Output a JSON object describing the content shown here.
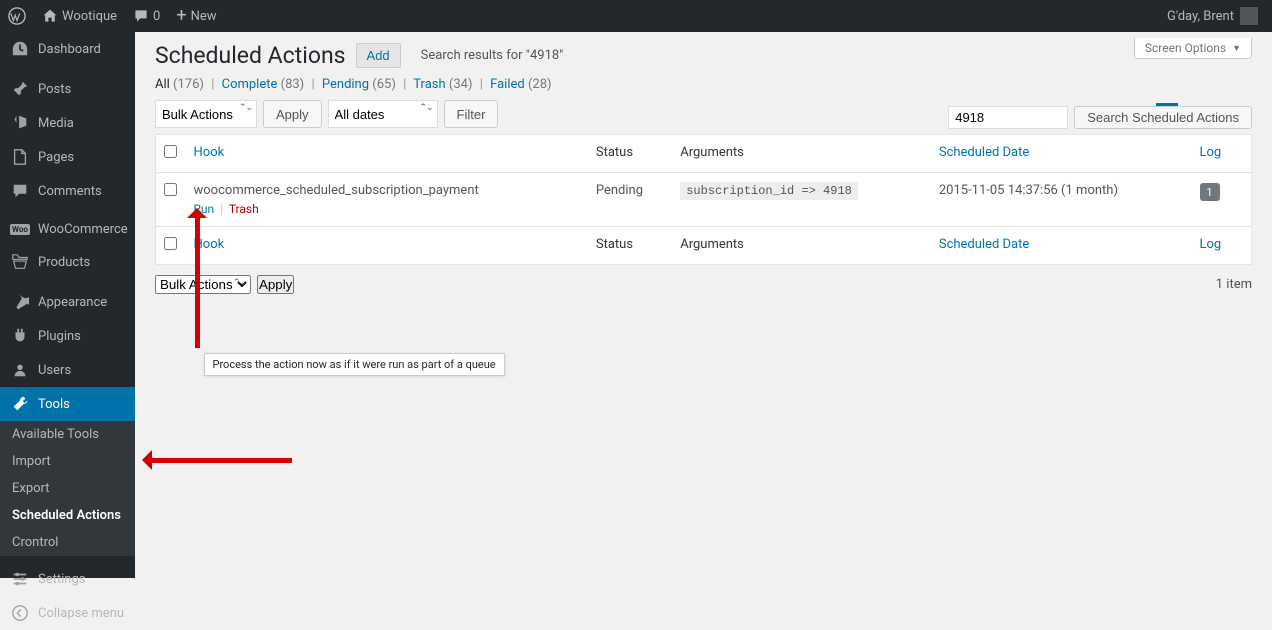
{
  "adminbar": {
    "site_name": "Wootique",
    "comments_count": "0",
    "new_label": "New",
    "greeting": "G'day, Brent"
  },
  "sidebar": {
    "items": [
      {
        "icon": "dashboard",
        "label": "Dashboard"
      },
      {
        "icon": "pin",
        "label": "Posts"
      },
      {
        "icon": "media",
        "label": "Media"
      },
      {
        "icon": "page",
        "label": "Pages"
      },
      {
        "icon": "comment",
        "label": "Comments"
      },
      {
        "icon": "woo",
        "label": "WooCommerce"
      },
      {
        "icon": "product",
        "label": "Products"
      },
      {
        "icon": "appearance",
        "label": "Appearance"
      },
      {
        "icon": "plugin",
        "label": "Plugins"
      },
      {
        "icon": "users",
        "label": "Users"
      },
      {
        "icon": "tools",
        "label": "Tools"
      },
      {
        "icon": "settings",
        "label": "Settings"
      },
      {
        "icon": "collapse",
        "label": "Collapse menu"
      }
    ],
    "submenu": {
      "items": [
        "Available Tools",
        "Import",
        "Export",
        "Scheduled Actions",
        "Crontrol"
      ],
      "current": "Scheduled Actions"
    }
  },
  "header": {
    "title": "Scheduled Actions",
    "add_label": "Add",
    "search_prefix": "Search results for ",
    "search_term": "\"4918\"",
    "screen_options_label": "Screen Options"
  },
  "filters": {
    "all_label": "All",
    "all_count": "(176)",
    "complete_label": "Complete",
    "complete_count": "(83)",
    "pending_label": "Pending",
    "pending_count": "(65)",
    "trash_label": "Trash",
    "trash_count": "(34)",
    "failed_label": "Failed",
    "failed_count": "(28)"
  },
  "search": {
    "value": "4918",
    "button": "Search Scheduled Actions"
  },
  "tablenav": {
    "bulk_label": "Bulk Actions",
    "apply_label": "Apply",
    "dates_label": "All dates",
    "filter_label": "Filter",
    "item_count": "1 item"
  },
  "table": {
    "columns": {
      "hook": "Hook",
      "status": "Status",
      "arguments": "Arguments",
      "scheduled": "Scheduled Date",
      "log": "Log"
    },
    "rows": [
      {
        "hook": "woocommerce_scheduled_subscription_payment",
        "status": "Pending",
        "arguments": "subscription_id => 4918",
        "scheduled": "2015-11-05 14:37:56 (1 month)",
        "log_count": "1",
        "actions": {
          "run": "Run",
          "trash": "Trash"
        },
        "tooltip": "Process the action now as if it were run as part of a queue"
      }
    ]
  }
}
